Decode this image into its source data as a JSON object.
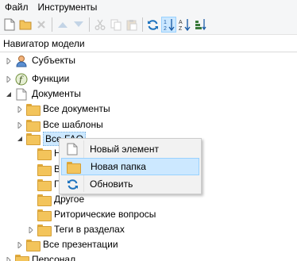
{
  "menubar": {
    "items": [
      "Файл",
      "Инструменты"
    ]
  },
  "toolbar": {
    "buttons": [
      {
        "icon": "new-document-icon",
        "enabled": true
      },
      {
        "icon": "open-folder-icon",
        "enabled": true
      },
      {
        "icon": "delete-icon",
        "enabled": false
      },
      {
        "icon": "move-up-icon",
        "enabled": false
      },
      {
        "icon": "move-down-icon",
        "enabled": false
      },
      {
        "icon": "cut-icon",
        "enabled": false
      },
      {
        "icon": "copy-icon",
        "enabled": false
      },
      {
        "icon": "paste-icon",
        "enabled": false
      },
      {
        "icon": "refresh-icon",
        "enabled": true
      },
      {
        "icon": "sort-numeric-icon",
        "enabled": true,
        "checked": true
      },
      {
        "icon": "sort-alpha-icon",
        "enabled": true
      },
      {
        "icon": "sort-size-icon",
        "enabled": true
      }
    ]
  },
  "panel": {
    "title": "Навигатор модели"
  },
  "tree": {
    "nodes": [
      {
        "label": "Субъекты",
        "icon": "subjects-icon",
        "expander": "collapsed"
      },
      {
        "label": "Функции",
        "icon": "function-icon",
        "expander": "collapsed"
      },
      {
        "label": "Документы",
        "icon": "document-icon",
        "expander": "expanded"
      },
      {
        "label": "Все документы",
        "icon": "folder-icon",
        "expander": "collapsed"
      },
      {
        "label": "Все шаблоны",
        "icon": "folder-icon",
        "expander": "collapsed"
      },
      {
        "label": "Все FAQ",
        "icon": "folder-icon",
        "expander": "expanded",
        "selected": true
      },
      {
        "label": "Н",
        "icon": "folder-icon",
        "expander": "none"
      },
      {
        "label": "В",
        "icon": "folder-icon",
        "expander": "none"
      },
      {
        "label": "Г",
        "icon": "folder-icon",
        "expander": "none"
      },
      {
        "label": "Другое",
        "icon": "folder-icon",
        "expander": "none"
      },
      {
        "label": "Риторические вопросы",
        "icon": "folder-icon",
        "expander": "none"
      },
      {
        "label": "Теги в разделах",
        "icon": "folder-icon",
        "expander": "collapsed"
      },
      {
        "label": "Все презентации",
        "icon": "folder-icon",
        "expander": "collapsed"
      },
      {
        "label": "Персонал",
        "icon": "folder-icon",
        "expander": "collapsed"
      }
    ]
  },
  "context_menu": {
    "items": [
      {
        "label": "Новый элемент",
        "icon": "new-document-icon"
      },
      {
        "label": "Новая папка",
        "icon": "folder-icon",
        "highlighted": true
      },
      {
        "label": "Обновить",
        "icon": "refresh-icon"
      }
    ]
  },
  "colors": {
    "selection": "#cce8ff",
    "folder": "#f3c45b",
    "accent": "#1e73be"
  }
}
